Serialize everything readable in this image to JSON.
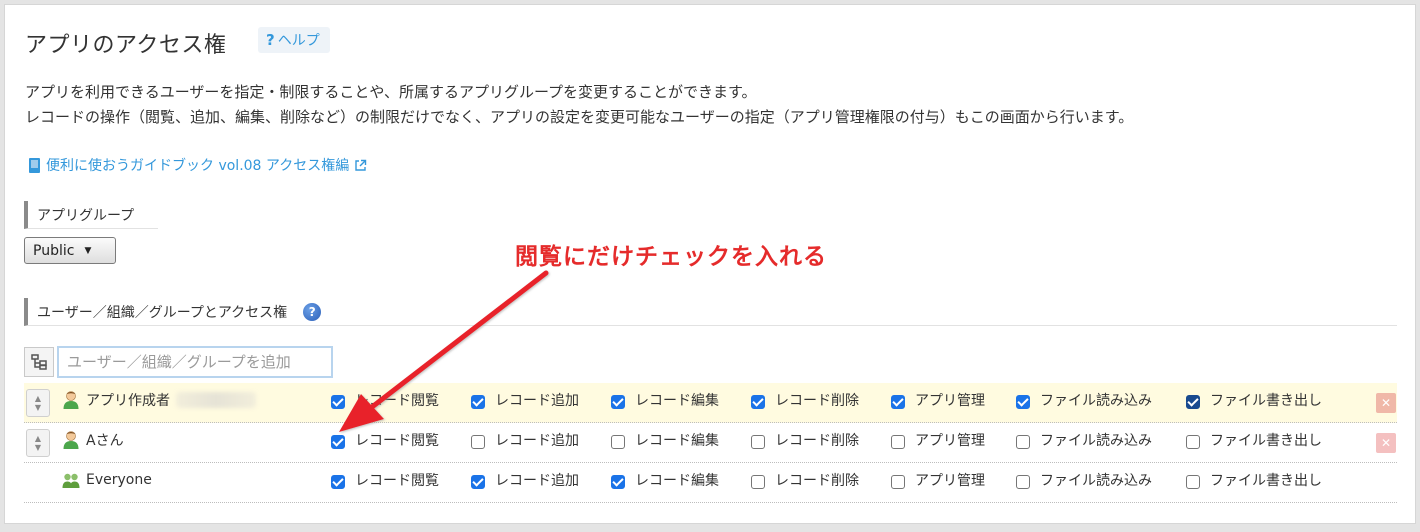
{
  "header": {
    "title": "アプリのアクセス権",
    "help_label": "ヘルプ",
    "help_symbol": "?"
  },
  "description": {
    "line1": "アプリを利用できるユーザーを指定・制限することや、所属するアプリグループを変更することができます。",
    "line2": "レコードの操作（閲覧、追加、編集、削除など）の制限だけでなく、アプリの設定を変更可能なユーザーの指定（アプリ管理権限の付与）もこの画面から行います。"
  },
  "guide_link": {
    "label": "便利に使おうガイドブック vol.08 アクセス権編",
    "icon": "book-icon",
    "external_icon": "external-link-icon"
  },
  "app_group": {
    "heading": "アプリグループ",
    "selected": "Public"
  },
  "users_section": {
    "heading": "ユーザー／組織／グループとアクセス権",
    "help_symbol": "?",
    "add_placeholder": "ユーザー／組織／グループを追加"
  },
  "annotation": {
    "text": "閲覧にだけチェックを入れる",
    "color": "#e52b2b"
  },
  "permission_labels": [
    "レコード閲覧",
    "レコード追加",
    "レコード編集",
    "レコード削除",
    "アプリ管理",
    "ファイル読み込み",
    "ファイル書き出し"
  ],
  "rows": [
    {
      "name": "アプリ作成者",
      "icon": "person-icon",
      "highlight": true,
      "checks": [
        true,
        true,
        true,
        true,
        true,
        true,
        true
      ]
    },
    {
      "name": "Aさん",
      "icon": "person-icon",
      "highlight": false,
      "checks": [
        true,
        false,
        false,
        false,
        false,
        false,
        false
      ]
    },
    {
      "name": "Everyone",
      "icon": "group-icon",
      "highlight": false,
      "checks": [
        true,
        true,
        true,
        false,
        false,
        false,
        false
      ]
    }
  ],
  "colors": {
    "accent": "#3498db",
    "checkbox_on": "#1a73e8",
    "row_highlight": "#fffbe0"
  }
}
